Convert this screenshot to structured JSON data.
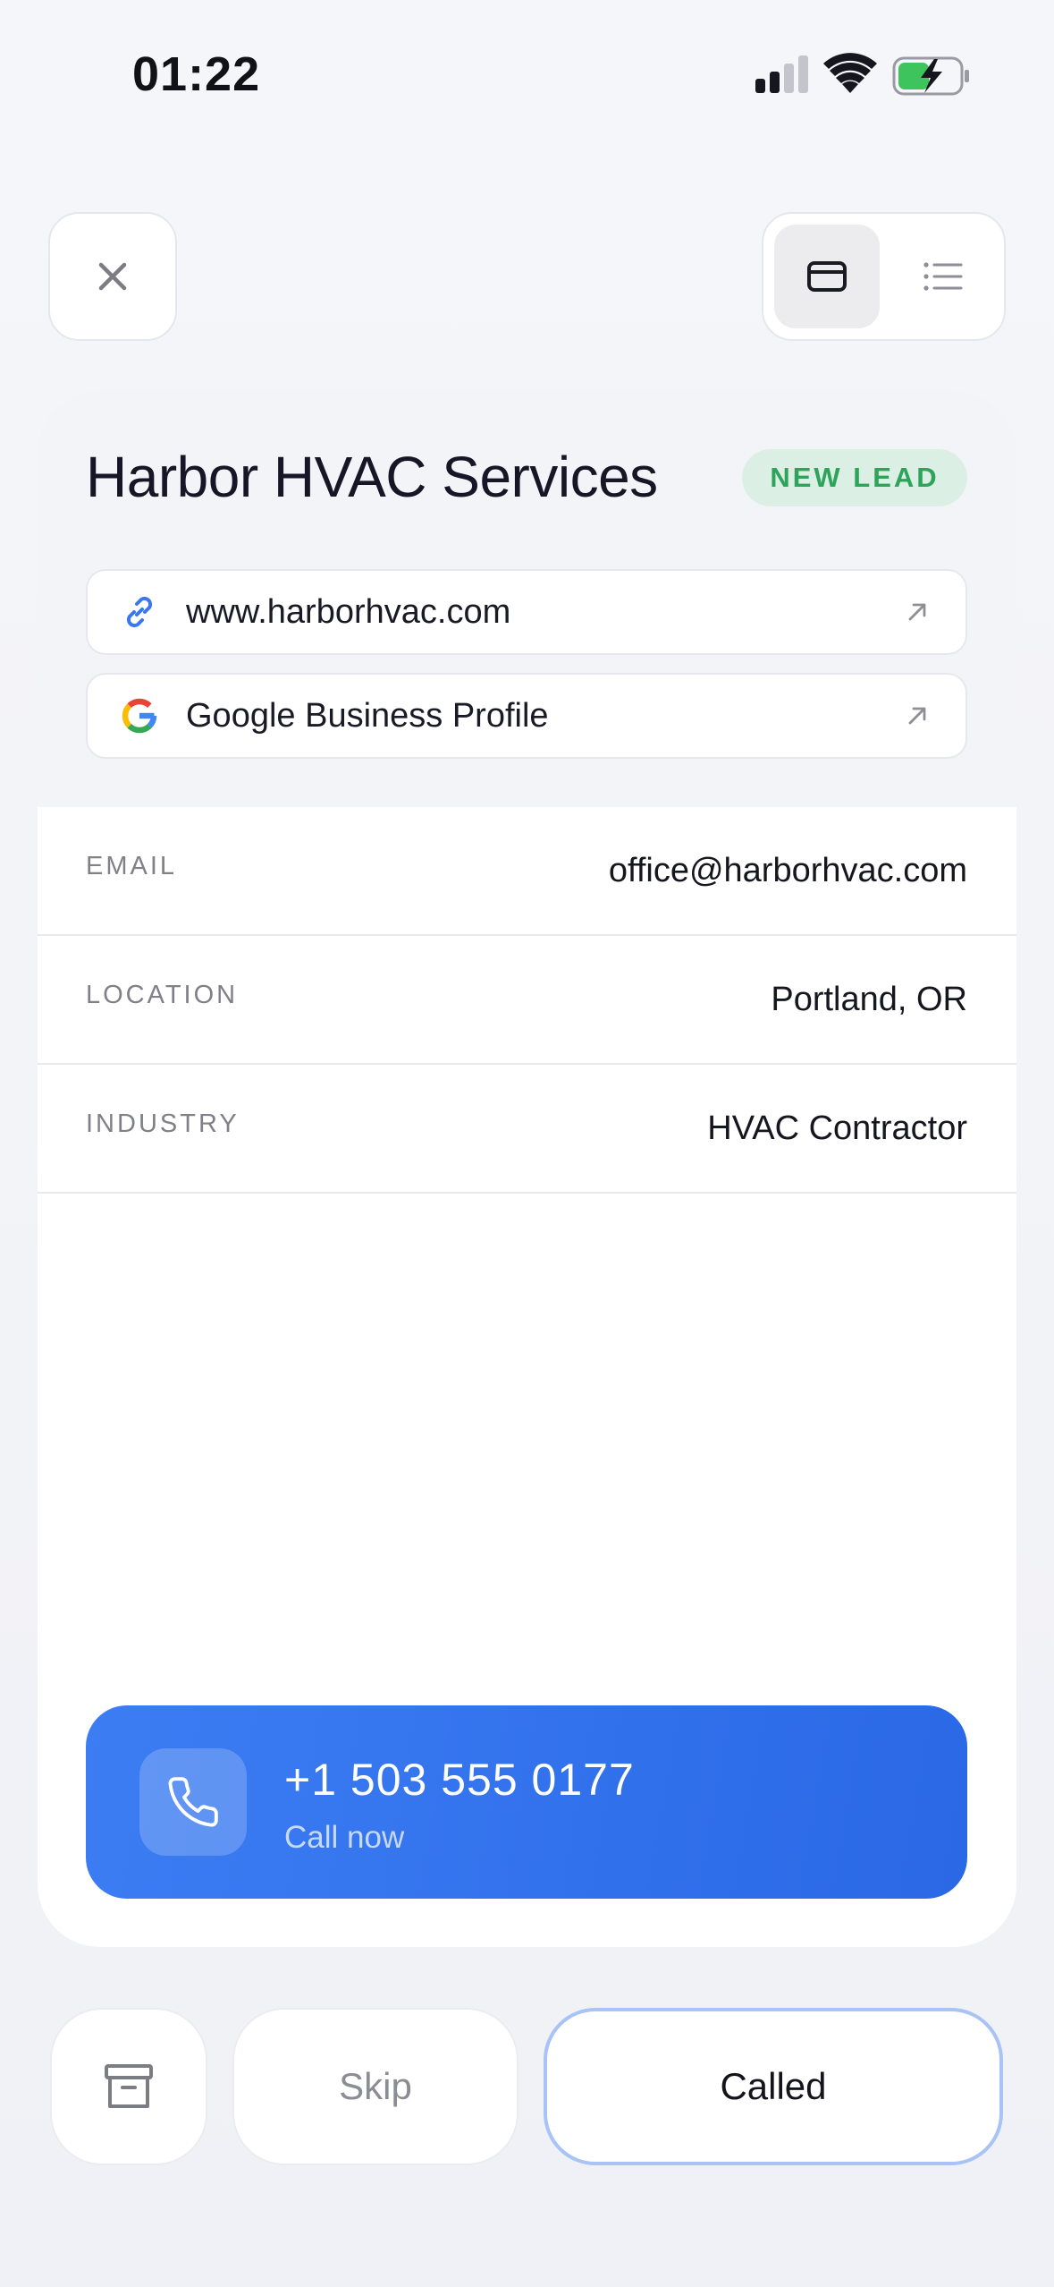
{
  "status_bar": {
    "time": "01:22",
    "icons": [
      "cellular-signal-icon",
      "wifi-icon",
      "battery-charging-icon"
    ]
  },
  "top_controls": {
    "close_icon": "close-icon",
    "view_toggle": {
      "selected": "card-view",
      "options": [
        "card-view-icon",
        "list-view-icon"
      ]
    }
  },
  "lead": {
    "company_name": "Harbor HVAC Services",
    "status_badge": "NEW LEAD",
    "links": [
      {
        "label": "www.harborhvac.com",
        "icon": "link-icon"
      },
      {
        "label": "Google Business Profile",
        "icon": "google-icon"
      }
    ],
    "details": [
      {
        "label": "EMAIL",
        "value": "office@harborhvac.com"
      },
      {
        "label": "LOCATION",
        "value": "Portland, OR"
      },
      {
        "label": "INDUSTRY",
        "value": "HVAC Contractor"
      }
    ],
    "call": {
      "number": "+1 503 555 0177",
      "subtitle": "Call now"
    }
  },
  "actions": {
    "archive_icon": "archive-icon",
    "skip_label": "Skip",
    "called_label": "Called"
  },
  "colors": {
    "accent_blue": "#3272ee",
    "badge_green": "#2ea45b",
    "badge_green_bg": "#dcefe4",
    "called_border": "#a9c3f6",
    "background": "#f3f4f8"
  }
}
